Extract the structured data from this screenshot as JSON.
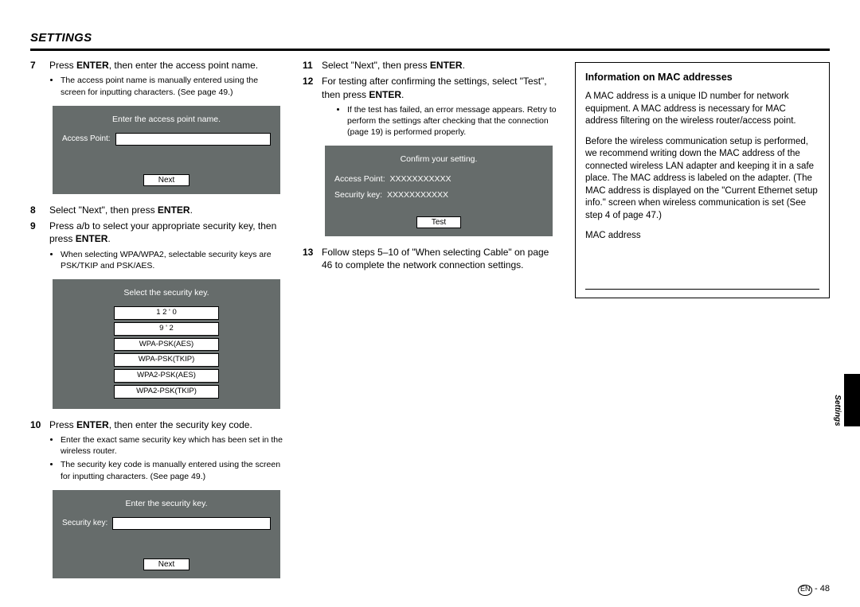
{
  "title": "SETTINGS",
  "steps": {
    "s7": {
      "num": "7",
      "text_a": "Press ",
      "text_b": "ENTER",
      "text_c": ", then enter the access point name.",
      "bullet1": "The access point name is manually entered using the screen for inputting characters. (See page 49.)"
    },
    "scr7": {
      "title": "Enter the access point name.",
      "label": "Access Point:",
      "btn": "Next"
    },
    "s8": {
      "num": "8",
      "text_a": "Select \"Next\", then press ",
      "text_b": "ENTER",
      "text_c": "."
    },
    "s9": {
      "num": "9",
      "text_a": "Press a/b    to select your appropriate security key, then press ",
      "text_b": "ENTER",
      "text_c": ".",
      "bullet1": "When selecting WPA/WPA2, selectable security keys are PSK/TKIP and PSK/AES."
    },
    "scr9": {
      "title": "Select the security key.",
      "opt1": "1 2 ' 0",
      "opt2": "9 ' 2",
      "opt3": "WPA-PSK(AES)",
      "opt4": "WPA-PSK(TKIP)",
      "opt5": "WPA2-PSK(AES)",
      "opt6": "WPA2-PSK(TKIP)"
    },
    "s10": {
      "num": "10",
      "text_a": "Press ",
      "text_b": "ENTER",
      "text_c": ", then enter the security key code.",
      "bullet1": "Enter the exact same security key which has been set in the wireless router.",
      "bullet2": "The security key code is manually entered using the screen for inputting characters. (See page 49.)"
    },
    "scr10": {
      "title": "Enter the security key.",
      "label": "Security key:",
      "btn": "Next"
    },
    "s11": {
      "num": "11",
      "text_a": "Select \"Next\", then press ",
      "text_b": "ENTER",
      "text_c": "."
    },
    "s12": {
      "num": "12",
      "text_a": "For testing after confirming the settings, select \"Test\", then press ",
      "text_b": "ENTER",
      "text_c": ".",
      "bullet1": "If the test has failed, an error message appears. Retry to perform the settings after checking that the connection (page 19) is performed properly."
    },
    "scr12": {
      "title": "Confirm your setting.",
      "row1_label": "Access Point:",
      "row1_val": "XXXXXXXXXXX",
      "row2_label": "Security key:",
      "row2_val": "XXXXXXXXXXX",
      "btn": "Test"
    },
    "s13": {
      "num": "13",
      "text": "Follow steps 5–10 of \"When selecting Cable\" on page 46 to complete the network connection settings."
    }
  },
  "info": {
    "title": "Information on MAC addresses",
    "p1": "A MAC address is a unique ID number for network equipment. A MAC address is necessary for MAC address filtering on the wireless router/access point.",
    "p2": "Before the wireless communication setup is performed, we recommend writing down the MAC address of the connected wireless LAN adapter and keeping it in a safe place. The MAC address is labeled on the adapter. (The MAC address is displayed on the \"Current Ethernet setup info.\" screen when wireless communication is set (See step 4 of page 47.)",
    "mac_label": "MAC address"
  },
  "side_label": "Settings",
  "page_en": "EN",
  "page_sep": " - ",
  "page_num": "48"
}
